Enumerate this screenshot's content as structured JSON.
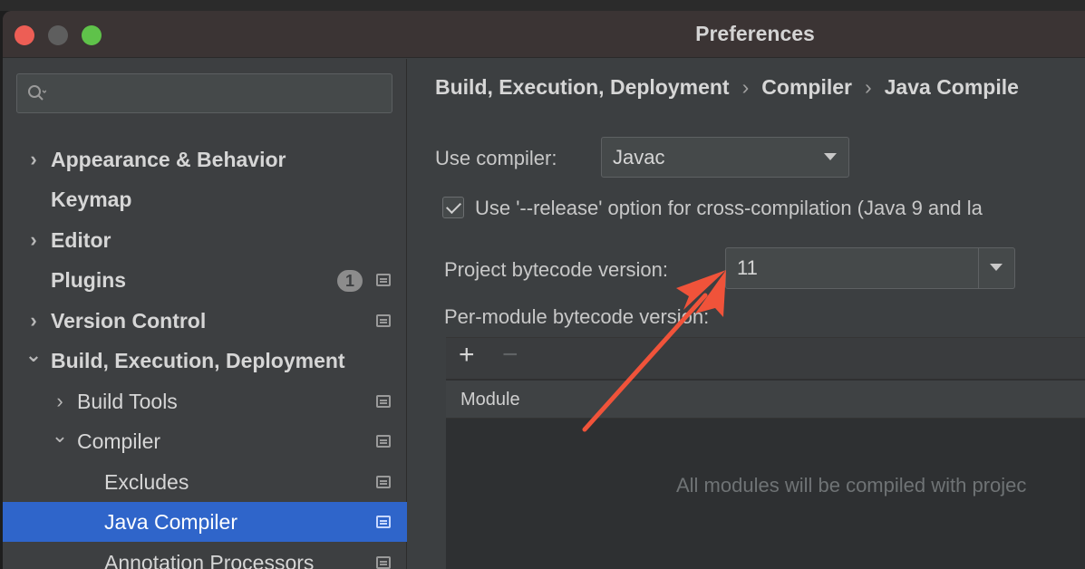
{
  "window": {
    "title": "Preferences"
  },
  "sidebar": {
    "search": {
      "placeholder": ""
    },
    "items": [
      {
        "label": "Appearance & Behavior",
        "expandable": true,
        "expanded": false,
        "bold": true
      },
      {
        "label": "Keymap",
        "expandable": false,
        "bold": true
      },
      {
        "label": "Editor",
        "expandable": true,
        "expanded": false,
        "bold": true
      },
      {
        "label": "Plugins",
        "expandable": false,
        "bold": true,
        "badge": "1"
      },
      {
        "label": "Version Control",
        "expandable": true,
        "expanded": false,
        "bold": true
      },
      {
        "label": "Build, Execution, Deployment",
        "expandable": true,
        "expanded": true,
        "bold": true
      },
      {
        "label": "Build Tools",
        "expandable": true,
        "expanded": false
      },
      {
        "label": "Compiler",
        "expandable": true,
        "expanded": true
      },
      {
        "label": "Excludes"
      },
      {
        "label": "Java Compiler",
        "selected": true
      },
      {
        "label": "Annotation Processors"
      }
    ]
  },
  "main": {
    "breadcrumb": [
      "Build, Execution, Deployment",
      "Compiler",
      "Java Compile"
    ],
    "breadcrumb_separator": "›",
    "use_compiler": {
      "label": "Use compiler:",
      "value": "Javac"
    },
    "release_option": {
      "label": "Use '--release' option for cross-compilation (Java 9 and la",
      "checked": true
    },
    "project_bytecode": {
      "label": "Project bytecode version:",
      "value": "11"
    },
    "per_module": {
      "label": "Per-module bytecode version:"
    },
    "table": {
      "add_label": "+",
      "remove_label": "−",
      "columns": [
        "Module"
      ],
      "empty_text": "All modules will be compiled with projec"
    }
  },
  "colors": {
    "selection": "#2f65ca",
    "annotation_arrow": "#f0533a"
  },
  "chevrons": {
    "collapsed": "›",
    "expanded": "⌄"
  }
}
